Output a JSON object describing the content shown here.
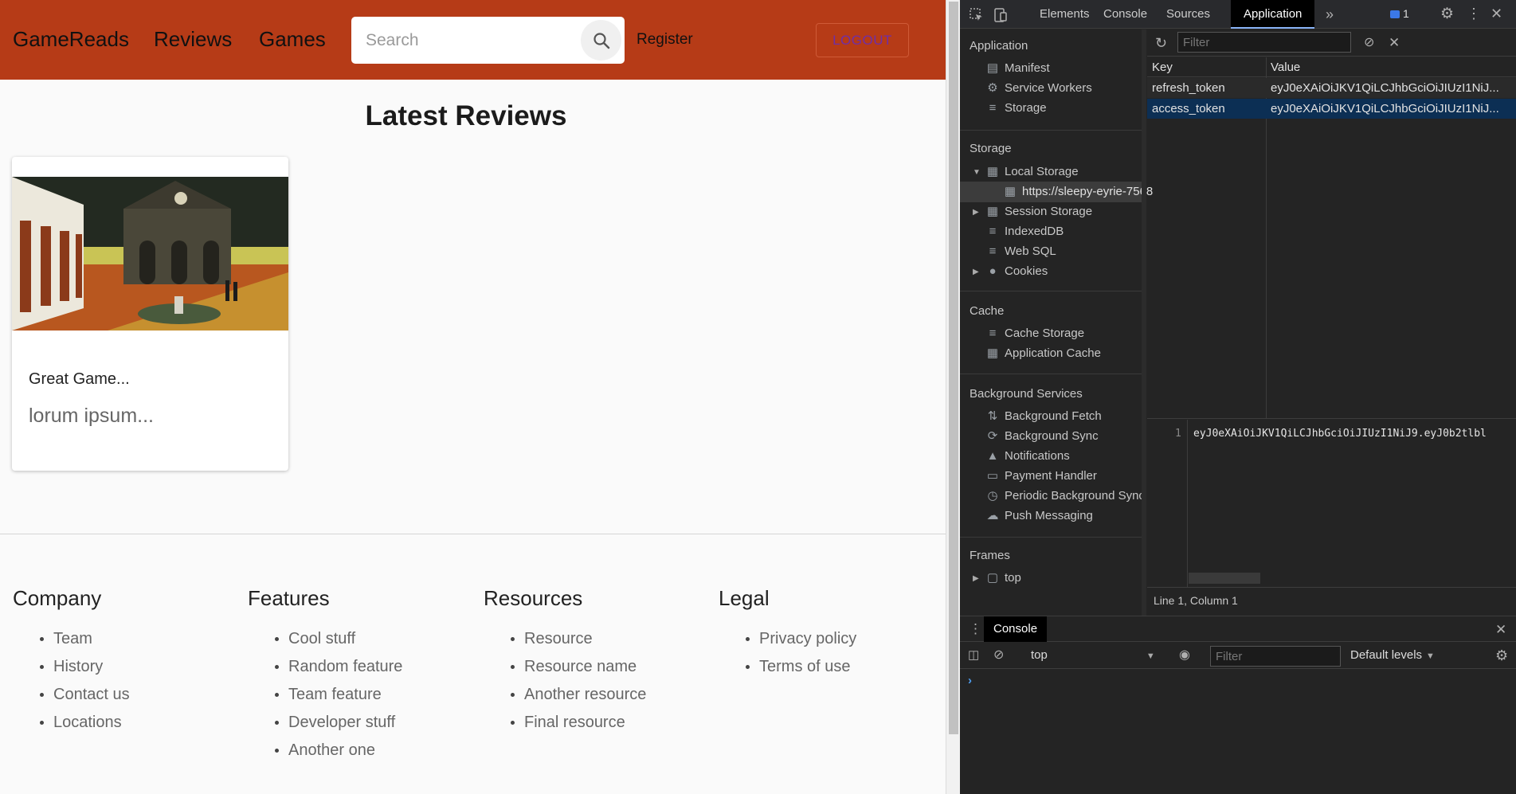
{
  "site": {
    "nav": {
      "brand": "GameReads",
      "reviews": "Reviews",
      "games": "Games"
    },
    "search": {
      "placeholder": "Search"
    },
    "register": "Register",
    "logout": "LOGOUT",
    "section_title": "Latest Reviews",
    "review_card": {
      "title": "Great Game...",
      "text": "lorum ipsum..."
    },
    "footer": {
      "columns": [
        {
          "heading": "Company",
          "links": [
            "Team",
            "History",
            "Contact us",
            "Locations"
          ]
        },
        {
          "heading": "Features",
          "links": [
            "Cool stuff",
            "Random feature",
            "Team feature",
            "Developer stuff",
            "Another one"
          ]
        },
        {
          "heading": "Resources",
          "links": [
            "Resource",
            "Resource name",
            "Another resource",
            "Final resource"
          ]
        },
        {
          "heading": "Legal",
          "links": [
            "Privacy policy",
            "Terms of use"
          ]
        }
      ]
    },
    "colors": {
      "header": "#b63b17",
      "logout_text": "#6e2ea8"
    }
  },
  "devtools": {
    "tabs": [
      "Elements",
      "Console",
      "Sources",
      "Application"
    ],
    "active_tab": "Application",
    "message_count": "1",
    "sidebar": {
      "application": {
        "heading": "Application",
        "items": [
          "Manifest",
          "Service Workers",
          "Storage"
        ]
      },
      "storage": {
        "heading": "Storage",
        "local_storage": "Local Storage",
        "local_storage_origin": "https://sleepy-eyrie-7568",
        "items": [
          "Session Storage",
          "IndexedDB",
          "Web SQL",
          "Cookies"
        ]
      },
      "cache": {
        "heading": "Cache",
        "items": [
          "Cache Storage",
          "Application Cache"
        ]
      },
      "background": {
        "heading": "Background Services",
        "items": [
          "Background Fetch",
          "Background Sync",
          "Notifications",
          "Payment Handler",
          "Periodic Background Sync",
          "Push Messaging"
        ]
      },
      "frames": {
        "heading": "Frames",
        "items": [
          "top"
        ]
      }
    },
    "storage_table": {
      "filter_placeholder": "Filter",
      "columns": [
        "Key",
        "Value"
      ],
      "rows": [
        {
          "key": "refresh_token",
          "value": "eyJ0eXAiOiJKV1QiLCJhbGciOiJIUzI1NiJ..."
        },
        {
          "key": "access_token",
          "value": "eyJ0eXAiOiJKV1QiLCJhbGciOiJIUzI1NiJ..."
        }
      ],
      "selected_row": 1
    },
    "preview": {
      "line_number": "1",
      "text": "eyJ0eXAiOiJKV1QiLCJhbGciOiJIUzI1NiJ9.eyJ0b2tlbl"
    },
    "status": "Line 1, Column 1",
    "drawer": {
      "tab": "Console",
      "context": "top",
      "filter_placeholder": "Filter",
      "levels": "Default levels",
      "prompt": "›"
    }
  }
}
